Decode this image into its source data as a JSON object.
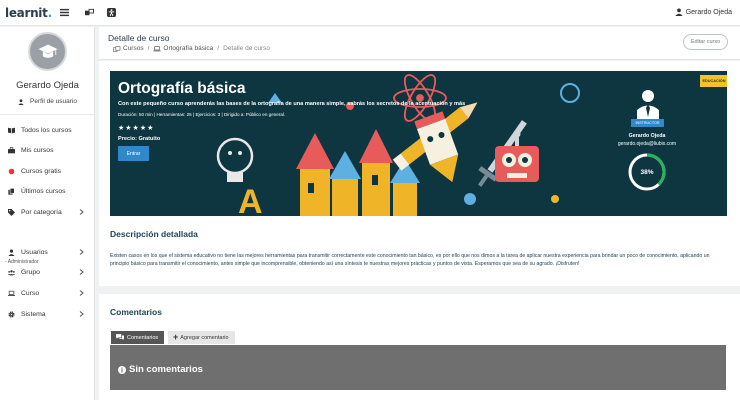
{
  "app": {
    "logo_main": "learnit",
    "logo_accent": "."
  },
  "topbar": {
    "user_name": "Gerardo Ojeda",
    "icons": [
      "hamburger-icon",
      "group-icon",
      "accessibility-icon"
    ]
  },
  "sidebar": {
    "user_name": "Gerardo Ojeda",
    "profile_label": "Perfil de usuario",
    "nav": [
      {
        "label": "Todos los cursos",
        "icon": "book-icon"
      },
      {
        "label": "Mis cursos",
        "icon": "briefcase-icon"
      },
      {
        "label": "Cursos gratis",
        "icon": "red-dot-icon"
      },
      {
        "label": "Últimos cursos",
        "icon": "copy-icon"
      },
      {
        "label": "Por categoría",
        "icon": "tag-icon"
      }
    ],
    "admin_section": "- Administrador",
    "admin": [
      {
        "label": "Usuarios",
        "icon": "user-icon"
      },
      {
        "label": "Grupo",
        "icon": "users-icon"
      },
      {
        "label": "Curso",
        "icon": "laptop-icon"
      },
      {
        "label": "Sistema",
        "icon": "cog-icon"
      }
    ],
    "colors": {
      "free_dot": "#e53935"
    }
  },
  "header": {
    "title": "Detalle de curso",
    "breadcrumb": {
      "item1": "Cursos",
      "item2": "Ortografía básica",
      "current": "Detalle de curso"
    },
    "edit_button": "Editar curso"
  },
  "course": {
    "title": "Ortografía básica",
    "subtitle": "Con este pequeño curso aprenderás las bases de la ortografía de una manera simple, sabrás los secretos de la acentuación y más",
    "meta": "Duración: 50 min | Herramientas: 25 | Ejercicios: 3 | Dirigido a: Público en general.",
    "stars": "★★★★★",
    "rating": 5,
    "price": "Precio: Gratuito",
    "enter_button": "Entrar",
    "badge": "EDUCACIÓN",
    "instructor_tag": "INSTRUCTOR",
    "instructor_name": "Gerardo Ojeda",
    "instructor_email": "gerardo.ojeda@liubix.com",
    "progress_label": "38%",
    "progress_value": 38,
    "colors": {
      "banner": "#0d3640",
      "accent": "#2f89c9",
      "badge": "#f3c228",
      "progress": "#27b35a"
    }
  },
  "description": {
    "title": "Descripción detallada",
    "text": "Existen casos en los que el sistema educativo no tiene las mejores herramientas para transmitir correctamente este conocimiento tan básico, es por ello que nos dimos a la tarea de aplicar nuestra experiencia para brindar un poco de conocimiento, aplicando un principio básico para transmitir el conocimiento, antes simple que incomprensible, obteniendo así una síntesis te nuestras mejores prácticas y puntos de vista. Esperamos que sea de su agrado. ¡Disfruten!"
  },
  "comments": {
    "title": "Comentarios",
    "tab_comments": "Comentarios",
    "tab_add": "Agregar comentario",
    "empty": "Sin comentarios"
  }
}
